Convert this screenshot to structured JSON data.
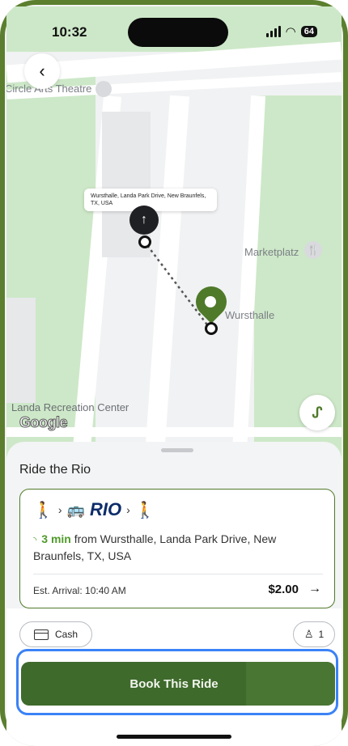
{
  "status_bar": {
    "time": "10:32",
    "battery": "64"
  },
  "map": {
    "labels": {
      "theatre": "Circle Arts Theatre",
      "marketplatz": "Marketplatz",
      "wursthalle": "Wursthalle",
      "landa": "Landa Recreation Center",
      "google": "Google"
    },
    "callout": "Wursthalle, Landa Park Drive, New Braunfels, TX, USA"
  },
  "sheet": {
    "title": "Ride the Rio",
    "card": {
      "brand": "RIO",
      "eta_minutes": "3 min",
      "eta_text": " from Wursthalle, Landa Park Drive, New Braunfels, TX, USA",
      "arrival": "Est. Arrival: 10:40 AM",
      "price": "$2.00"
    },
    "payment": "Cash",
    "passengers": "1",
    "book_button": "Book This Ride"
  },
  "colors": {
    "accent": "#4f7a2a",
    "button": "#3e6a2b",
    "highlight": "#3b82f6"
  }
}
